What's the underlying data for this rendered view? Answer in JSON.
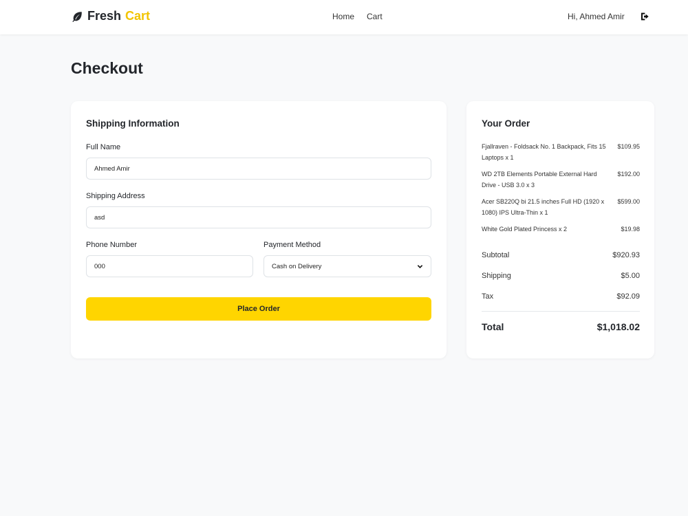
{
  "navbar": {
    "brand_part1": "Fresh",
    "brand_part2": "Cart",
    "brand_icon": "leaf-icon",
    "links": [
      {
        "label": "Home"
      },
      {
        "label": "Cart"
      }
    ],
    "greeting": "Hi, Ahmed Amir",
    "logout_icon": "sign-out-icon"
  },
  "page": {
    "title": "Checkout"
  },
  "shipping": {
    "title": "Shipping Information",
    "full_name_label": "Full Name",
    "full_name_value": "Ahmed Amir",
    "address_label": "Shipping Address",
    "address_value": "asd",
    "phone_label": "Phone Number",
    "phone_value": "000",
    "payment_label": "Payment Method",
    "payment_value": "Cash on Delivery",
    "place_order_label": "Place Order"
  },
  "order": {
    "title": "Your Order",
    "items": [
      {
        "name": "Fjallraven - Foldsack No. 1 Backpack, Fits 15 Laptops x 1",
        "price": "$109.95"
      },
      {
        "name": "WD 2TB Elements Portable External Hard Drive - USB 3.0 x 3",
        "price": "$192.00"
      },
      {
        "name": "Acer SB220Q bi 21.5 inches Full HD (1920 x 1080) IPS Ultra-Thin x 1",
        "price": "$599.00"
      },
      {
        "name": "White Gold Plated Princess x 2",
        "price": "$19.98"
      }
    ],
    "subtotal_label": "Subtotal",
    "subtotal_value": "$920.93",
    "shipping_label": "Shipping",
    "shipping_value": "$5.00",
    "tax_label": "Tax",
    "tax_value": "$92.09",
    "total_label": "Total",
    "total_value": "$1,018.02"
  },
  "colors": {
    "accent": "#ffd500",
    "brand_dark": "#23262b",
    "brand_yellow": "#f2c400",
    "background": "#f8f9fa"
  }
}
